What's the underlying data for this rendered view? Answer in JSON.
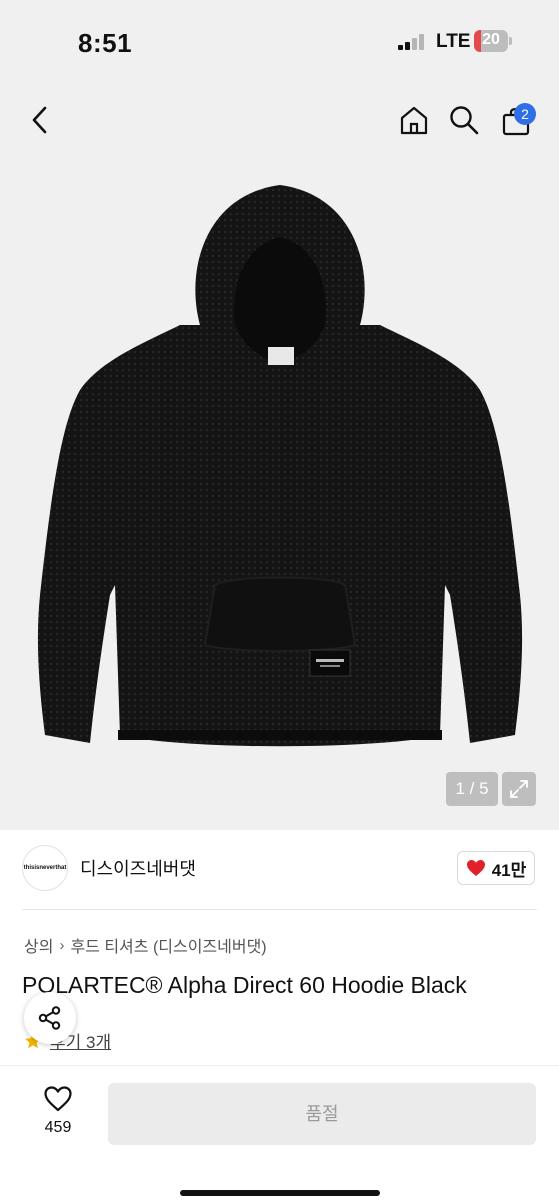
{
  "status": {
    "time": "8:51",
    "network": "LTE",
    "battery": "20",
    "battery_level": 0.2,
    "battery_color": "#e5484d"
  },
  "nav": {
    "back_icon": "chevron-left-icon",
    "home_icon": "home-icon",
    "search_icon": "search-icon",
    "cart_icon": "shopping-bag-icon",
    "cart_count": "2"
  },
  "gallery": {
    "pager": "1 / 5",
    "image_alt": "black hoodie"
  },
  "brand": {
    "logo_text": "thisisneverthat",
    "name": "디스이즈네버댓",
    "likes": "41만",
    "like_color": "#e0212b"
  },
  "breadcrumb": {
    "category": "상의",
    "subcategory": "후드 티셔츠 (디스이즈네버댓)"
  },
  "product": {
    "title": "POLARTEC® Alpha Direct 60 Hoodie Black",
    "rating_icon": "star-icon",
    "review_link": "후기 3개"
  },
  "bottom": {
    "wish_count": "459",
    "sold_out": "품절"
  }
}
